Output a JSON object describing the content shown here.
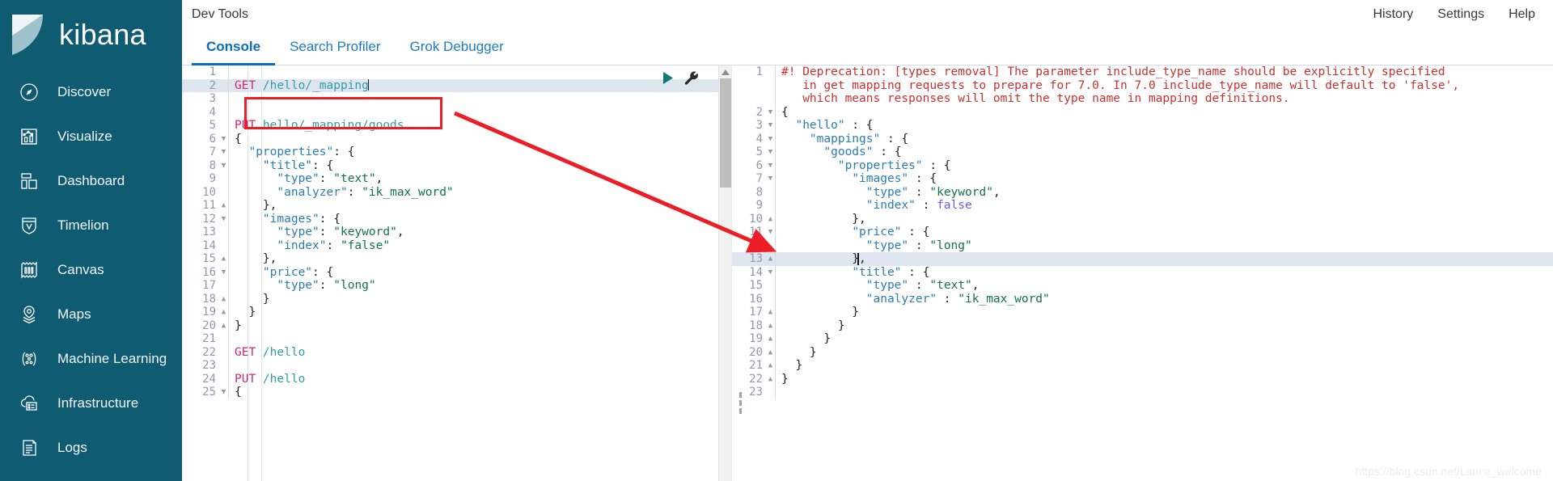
{
  "brand": {
    "name": "kibana",
    "logo_icon": "kibana-logo-icon"
  },
  "sidebar": {
    "items": [
      {
        "label": "Discover",
        "icon": "compass-icon"
      },
      {
        "label": "Visualize",
        "icon": "bar-chart-icon"
      },
      {
        "label": "Dashboard",
        "icon": "dashboard-grid-icon"
      },
      {
        "label": "Timelion",
        "icon": "timelion-shield-icon"
      },
      {
        "label": "Canvas",
        "icon": "canvas-frame-icon"
      },
      {
        "label": "Maps",
        "icon": "map-marker-layers-icon"
      },
      {
        "label": "Machine Learning",
        "icon": "machine-learning-nodes-icon"
      },
      {
        "label": "Infrastructure",
        "icon": "infrastructure-cloud-icon"
      },
      {
        "label": "Logs",
        "icon": "logs-scroll-icon"
      }
    ]
  },
  "header": {
    "title": "Dev Tools",
    "links": [
      {
        "label": "History"
      },
      {
        "label": "Settings"
      },
      {
        "label": "Help"
      }
    ]
  },
  "tabs": [
    {
      "label": "Console",
      "active": true
    },
    {
      "label": "Search Profiler",
      "active": false
    },
    {
      "label": "Grok Debugger",
      "active": false
    }
  ],
  "editor": {
    "run_icon": "play-triangle-icon",
    "wrench_icon": "wrench-icon",
    "scroll_up_icon": "chevron-up-icon",
    "splitter_icon": "drag-handle-icon",
    "request_lines": [
      {
        "n": 1,
        "fold": "",
        "tokens": []
      },
      {
        "n": 2,
        "fold": "",
        "highlight": true,
        "caret": true,
        "tokens": [
          {
            "t": "GET ",
            "c": "k-method"
          },
          {
            "t": "/hello/_mapping",
            "c": "k-url"
          }
        ]
      },
      {
        "n": 3,
        "fold": "",
        "tokens": []
      },
      {
        "n": 4,
        "fold": "",
        "tokens": []
      },
      {
        "n": 5,
        "fold": "",
        "tokens": [
          {
            "t": "PUT ",
            "c": "k-method"
          },
          {
            "t": "hello/_mapping/goods",
            "c": "k-url"
          }
        ]
      },
      {
        "n": 6,
        "fold": "down",
        "tokens": [
          {
            "t": "{",
            "c": "k-punct"
          }
        ]
      },
      {
        "n": 7,
        "fold": "down",
        "tokens": [
          {
            "t": "  ",
            "c": ""
          },
          {
            "t": "\"properties\"",
            "c": "k-key"
          },
          {
            "t": ": {",
            "c": "k-punct"
          }
        ]
      },
      {
        "n": 8,
        "fold": "down",
        "tokens": [
          {
            "t": "    ",
            "c": ""
          },
          {
            "t": "\"title\"",
            "c": "k-key"
          },
          {
            "t": ": {",
            "c": "k-punct"
          }
        ]
      },
      {
        "n": 9,
        "fold": "",
        "tokens": [
          {
            "t": "      ",
            "c": ""
          },
          {
            "t": "\"type\"",
            "c": "k-key"
          },
          {
            "t": ": ",
            "c": "k-punct"
          },
          {
            "t": "\"text\"",
            "c": "k-str"
          },
          {
            "t": ",",
            "c": "k-punct"
          }
        ]
      },
      {
        "n": 10,
        "fold": "",
        "tokens": [
          {
            "t": "      ",
            "c": ""
          },
          {
            "t": "\"analyzer\"",
            "c": "k-key"
          },
          {
            "t": ": ",
            "c": "k-punct"
          },
          {
            "t": "\"ik_max_word\"",
            "c": "k-str"
          }
        ]
      },
      {
        "n": 11,
        "fold": "up",
        "tokens": [
          {
            "t": "    },",
            "c": "k-punct"
          }
        ]
      },
      {
        "n": 12,
        "fold": "down",
        "tokens": [
          {
            "t": "    ",
            "c": ""
          },
          {
            "t": "\"images\"",
            "c": "k-key"
          },
          {
            "t": ": {",
            "c": "k-punct"
          }
        ]
      },
      {
        "n": 13,
        "fold": "",
        "tokens": [
          {
            "t": "      ",
            "c": ""
          },
          {
            "t": "\"type\"",
            "c": "k-key"
          },
          {
            "t": ": ",
            "c": "k-punct"
          },
          {
            "t": "\"keyword\"",
            "c": "k-str"
          },
          {
            "t": ",",
            "c": "k-punct"
          }
        ]
      },
      {
        "n": 14,
        "fold": "",
        "tokens": [
          {
            "t": "      ",
            "c": ""
          },
          {
            "t": "\"index\"",
            "c": "k-key"
          },
          {
            "t": ": ",
            "c": "k-punct"
          },
          {
            "t": "\"false\"",
            "c": "k-str"
          }
        ]
      },
      {
        "n": 15,
        "fold": "up",
        "tokens": [
          {
            "t": "    },",
            "c": "k-punct"
          }
        ]
      },
      {
        "n": 16,
        "fold": "down",
        "tokens": [
          {
            "t": "    ",
            "c": ""
          },
          {
            "t": "\"price\"",
            "c": "k-key"
          },
          {
            "t": ": {",
            "c": "k-punct"
          }
        ]
      },
      {
        "n": 17,
        "fold": "",
        "tokens": [
          {
            "t": "      ",
            "c": ""
          },
          {
            "t": "\"type\"",
            "c": "k-key"
          },
          {
            "t": ": ",
            "c": "k-punct"
          },
          {
            "t": "\"long\"",
            "c": "k-str"
          }
        ]
      },
      {
        "n": 18,
        "fold": "up",
        "tokens": [
          {
            "t": "    }",
            "c": "k-punct"
          }
        ]
      },
      {
        "n": 19,
        "fold": "up",
        "tokens": [
          {
            "t": "  }",
            "c": "k-punct"
          }
        ]
      },
      {
        "n": 20,
        "fold": "up",
        "tokens": [
          {
            "t": "}",
            "c": "k-punct"
          }
        ]
      },
      {
        "n": 21,
        "fold": "",
        "tokens": []
      },
      {
        "n": 22,
        "fold": "",
        "tokens": [
          {
            "t": "GET ",
            "c": "k-method"
          },
          {
            "t": "/hello",
            "c": "k-url"
          }
        ]
      },
      {
        "n": 23,
        "fold": "",
        "tokens": []
      },
      {
        "n": 24,
        "fold": "",
        "tokens": [
          {
            "t": "PUT ",
            "c": "k-method"
          },
          {
            "t": "/hello",
            "c": "k-url"
          }
        ]
      },
      {
        "n": 25,
        "fold": "down",
        "tokens": [
          {
            "t": "{",
            "c": "k-punct"
          }
        ]
      }
    ],
    "response_lines": [
      {
        "n": 1,
        "fold": "",
        "tokens": [
          {
            "t": "#! Deprecation: [types removal] The parameter include_type_name should be explicitly specified",
            "c": "k-warn"
          }
        ]
      },
      {
        "n": "",
        "fold": "",
        "tokens": [
          {
            "t": "   in get mapping requests to prepare for 7.0. In 7.0 include_type_name will default to 'false',",
            "c": "k-warn"
          }
        ]
      },
      {
        "n": "",
        "fold": "",
        "tokens": [
          {
            "t": "   which means responses will omit the type name in mapping definitions.",
            "c": "k-warn"
          }
        ]
      },
      {
        "n": 2,
        "fold": "down",
        "tokens": [
          {
            "t": "{",
            "c": "k-punct"
          }
        ]
      },
      {
        "n": 3,
        "fold": "down",
        "tokens": [
          {
            "t": "  ",
            "c": ""
          },
          {
            "t": "\"hello\"",
            "c": "k-key"
          },
          {
            "t": " : {",
            "c": "k-punct"
          }
        ]
      },
      {
        "n": 4,
        "fold": "down",
        "tokens": [
          {
            "t": "    ",
            "c": ""
          },
          {
            "t": "\"mappings\"",
            "c": "k-key"
          },
          {
            "t": " : {",
            "c": "k-punct"
          }
        ]
      },
      {
        "n": 5,
        "fold": "down",
        "tokens": [
          {
            "t": "      ",
            "c": ""
          },
          {
            "t": "\"goods\"",
            "c": "k-key"
          },
          {
            "t": " : {",
            "c": "k-punct"
          }
        ]
      },
      {
        "n": 6,
        "fold": "down",
        "tokens": [
          {
            "t": "        ",
            "c": ""
          },
          {
            "t": "\"properties\"",
            "c": "k-key"
          },
          {
            "t": " : {",
            "c": "k-punct"
          }
        ]
      },
      {
        "n": 7,
        "fold": "down",
        "tokens": [
          {
            "t": "          ",
            "c": ""
          },
          {
            "t": "\"images\"",
            "c": "k-key"
          },
          {
            "t": " : {",
            "c": "k-punct"
          }
        ]
      },
      {
        "n": 8,
        "fold": "",
        "tokens": [
          {
            "t": "            ",
            "c": ""
          },
          {
            "t": "\"type\"",
            "c": "k-key"
          },
          {
            "t": " : ",
            "c": "k-punct"
          },
          {
            "t": "\"keyword\"",
            "c": "k-str"
          },
          {
            "t": ",",
            "c": "k-punct"
          }
        ]
      },
      {
        "n": 9,
        "fold": "",
        "tokens": [
          {
            "t": "            ",
            "c": ""
          },
          {
            "t": "\"index\"",
            "c": "k-key"
          },
          {
            "t": " : ",
            "c": "k-punct"
          },
          {
            "t": "false",
            "c": "k-lit"
          }
        ]
      },
      {
        "n": 10,
        "fold": "up",
        "tokens": [
          {
            "t": "          },",
            "c": "k-punct"
          }
        ]
      },
      {
        "n": 11,
        "fold": "down",
        "tokens": [
          {
            "t": "          ",
            "c": ""
          },
          {
            "t": "\"price\"",
            "c": "k-key"
          },
          {
            "t": " : {",
            "c": "k-punct"
          }
        ]
      },
      {
        "n": 12,
        "fold": "",
        "tokens": [
          {
            "t": "            ",
            "c": ""
          },
          {
            "t": "\"type\"",
            "c": "k-key"
          },
          {
            "t": " : ",
            "c": "k-punct"
          },
          {
            "t": "\"long\"",
            "c": "k-str"
          }
        ]
      },
      {
        "n": 13,
        "fold": "up",
        "highlight": true,
        "block_caret": true,
        "tokens": [
          {
            "t": "          },",
            "c": "k-punct"
          }
        ]
      },
      {
        "n": 14,
        "fold": "down",
        "tokens": [
          {
            "t": "          ",
            "c": ""
          },
          {
            "t": "\"title\"",
            "c": "k-key"
          },
          {
            "t": " : {",
            "c": "k-punct"
          }
        ]
      },
      {
        "n": 15,
        "fold": "",
        "tokens": [
          {
            "t": "            ",
            "c": ""
          },
          {
            "t": "\"type\"",
            "c": "k-key"
          },
          {
            "t": " : ",
            "c": "k-punct"
          },
          {
            "t": "\"text\"",
            "c": "k-str"
          },
          {
            "t": ",",
            "c": "k-punct"
          }
        ]
      },
      {
        "n": 16,
        "fold": "",
        "tokens": [
          {
            "t": "            ",
            "c": ""
          },
          {
            "t": "\"analyzer\"",
            "c": "k-key"
          },
          {
            "t": " : ",
            "c": "k-punct"
          },
          {
            "t": "\"ik_max_word\"",
            "c": "k-str"
          }
        ]
      },
      {
        "n": 17,
        "fold": "up",
        "tokens": [
          {
            "t": "          }",
            "c": "k-punct"
          }
        ]
      },
      {
        "n": 18,
        "fold": "up",
        "tokens": [
          {
            "t": "        }",
            "c": "k-punct"
          }
        ]
      },
      {
        "n": 19,
        "fold": "up",
        "tokens": [
          {
            "t": "      }",
            "c": "k-punct"
          }
        ]
      },
      {
        "n": 20,
        "fold": "up",
        "tokens": [
          {
            "t": "    }",
            "c": "k-punct"
          }
        ]
      },
      {
        "n": 21,
        "fold": "up",
        "tokens": [
          {
            "t": "  }",
            "c": "k-punct"
          }
        ]
      },
      {
        "n": 22,
        "fold": "up",
        "tokens": [
          {
            "t": "}",
            "c": "k-punct"
          }
        ]
      },
      {
        "n": 23,
        "fold": "",
        "tokens": []
      }
    ]
  },
  "annotations": {
    "highlight_box_label": "GET /hello/_mapping",
    "arrow_label": "points-to-response-line-9",
    "arrow_color": "#ee1c25",
    "box_color": "#ee1c25"
  },
  "watermark": {
    "text": "https://blog.csdn.net/Lance_welcome"
  }
}
